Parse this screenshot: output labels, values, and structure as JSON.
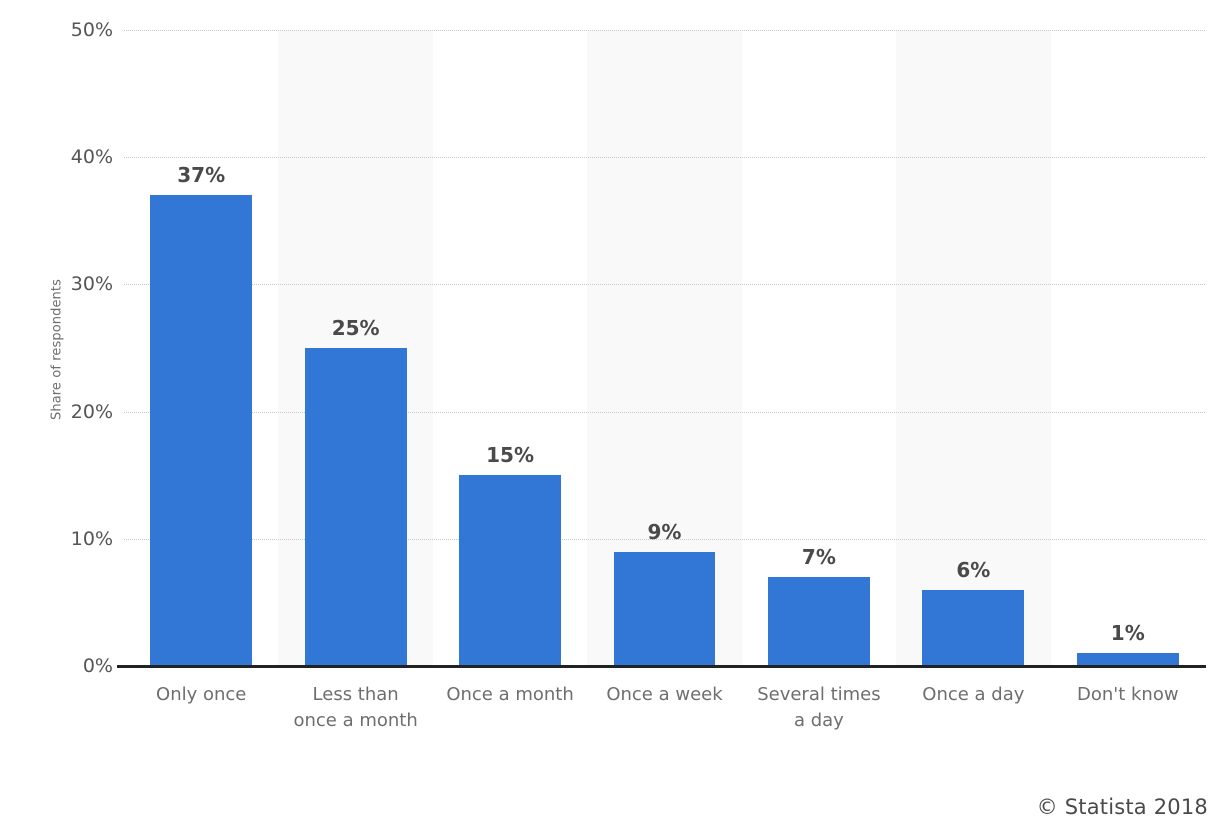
{
  "chart_data": {
    "type": "bar",
    "title": "",
    "subtitle": "",
    "xlabel": "",
    "ylabel": "Share of respondents",
    "ylim": [
      0,
      50
    ],
    "y_tick_labels": [
      "50%",
      "40%",
      "30%",
      "20%",
      "10%",
      "0%"
    ],
    "y_tick_values": [
      50,
      40,
      30,
      20,
      10,
      0
    ],
    "grid": true,
    "grid_style": "dotted-horizontal",
    "legend": null,
    "categories": [
      "Only once",
      "Less than\nonce a month",
      "Once a month",
      "Once a week",
      "Several times\na day",
      "Once a day",
      "Don't know"
    ],
    "values": [
      37,
      25,
      15,
      9,
      7,
      6,
      1
    ],
    "data_labels": [
      "37%",
      "25%",
      "15%",
      "9%",
      "7%",
      "6%",
      "1%"
    ],
    "series": [
      {
        "name": "Share of respondents",
        "values": [
          37,
          25,
          15,
          9,
          7,
          6,
          1
        ],
        "color": "#3377d6"
      }
    ]
  },
  "colors": {
    "bar": "#3377d6",
    "band": "#f9f9f9",
    "gridline": "#c9c9c9",
    "axis": "#222222",
    "tick_text": "#555555",
    "axis_title": "#6e6e6e",
    "value_text": "#4a4a4a",
    "background": "#ffffff"
  },
  "footer": {
    "credit": "© Statista 2018"
  }
}
